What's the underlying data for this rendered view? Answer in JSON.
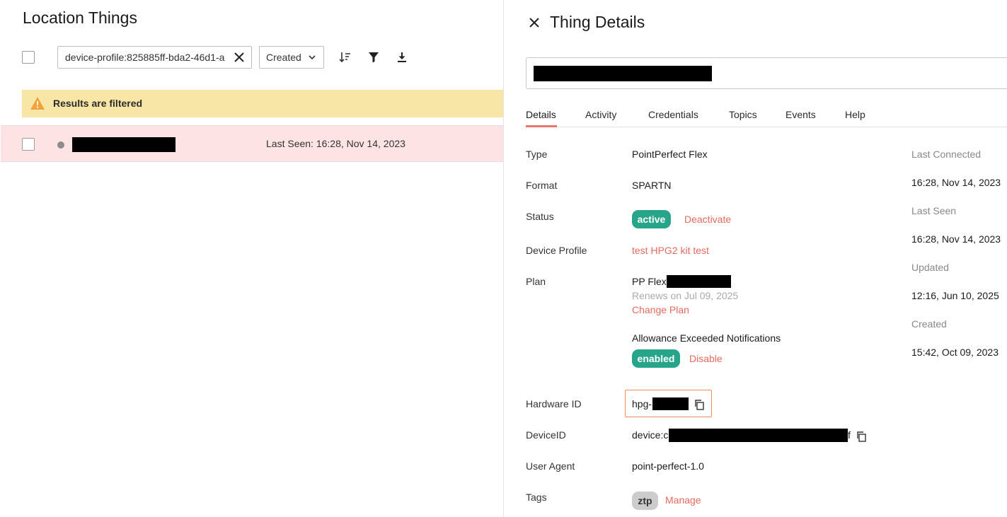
{
  "left": {
    "title": "Location Things",
    "search": {
      "value": "device-profile:825885ff-bda2-46d1-a"
    },
    "sort": {
      "selected": "Created"
    },
    "toolbar_icons": [
      "sort-icon",
      "filter-icon",
      "download-icon"
    ],
    "banner": {
      "text": "Results are filtered"
    },
    "rows": [
      {
        "status": "offline",
        "last_seen": "Last Seen: 16:28, Nov 14, 2023"
      }
    ]
  },
  "right": {
    "title": "Thing Details",
    "tabs": [
      "Details",
      "Activity",
      "Credentials",
      "Topics",
      "Events",
      "Help"
    ],
    "active_tab": "Details",
    "details": {
      "type": {
        "label": "Type",
        "value": "PointPerfect Flex"
      },
      "format": {
        "label": "Format",
        "value": "SPARTN"
      },
      "status": {
        "label": "Status",
        "badge": "active",
        "action": "Deactivate"
      },
      "device_profile": {
        "label": "Device Profile",
        "value": "test HPG2 kit test"
      },
      "plan": {
        "label": "Plan",
        "name": "PP Flex",
        "renews": "Renews on Jul 09, 2025",
        "change": "Change Plan",
        "allowance_label": "Allowance Exceeded Notifications",
        "allowance_badge": "enabled",
        "allowance_action": "Disable"
      },
      "hardware_id": {
        "label": "Hardware ID",
        "prefix": "hpg-"
      },
      "device_id": {
        "label": "DeviceID",
        "prefix": "device:c",
        "suffix": "f"
      },
      "user_agent": {
        "label": "User Agent",
        "value": "point-perfect-1.0"
      },
      "tags": {
        "label": "Tags",
        "tag": "ztp",
        "action": "Manage"
      }
    },
    "meta": {
      "last_connected": {
        "label": "Last Connected",
        "value": "16:28, Nov 14, 2023"
      },
      "last_seen": {
        "label": "Last Seen",
        "value": "16:28, Nov 14, 2023"
      },
      "updated": {
        "label": "Updated",
        "value": "12:16, Jun 10, 2025"
      },
      "created": {
        "label": "Created",
        "value": "15:42, Oct 09, 2023"
      }
    },
    "colors": {
      "accent": "#e46a5e",
      "badge": "#27a58a",
      "highlight_border": "#ef8e55",
      "filter_banner": "#f7e6a6",
      "row_highlight": "#fde3e3"
    }
  }
}
